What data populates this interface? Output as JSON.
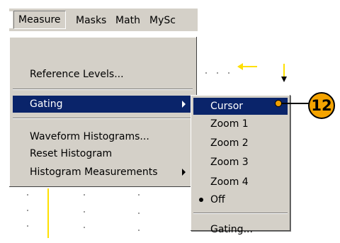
{
  "menubar": {
    "items": [
      "Measure",
      "Masks",
      "Math",
      "MySc"
    ]
  },
  "measure_menu": {
    "reference_levels": "Reference Levels...",
    "gating": "Gating",
    "waveform_histograms": "Waveform Histograms...",
    "reset_histogram": "Reset Histogram",
    "histogram_measurements": "Histogram Measurements"
  },
  "gating_submenu": {
    "items": [
      "Cursor",
      "Zoom 1",
      "Zoom 2",
      "Zoom 3",
      "Zoom 4",
      "Off"
    ],
    "selected": "Off",
    "highlighted": "Cursor",
    "settings": "Gating..."
  },
  "callout": {
    "number": "12"
  },
  "colors": {
    "menu_bg": "#d4d0c8",
    "highlight": "#0a246a",
    "callout": "#f4a300",
    "trace": "#ffe000"
  }
}
